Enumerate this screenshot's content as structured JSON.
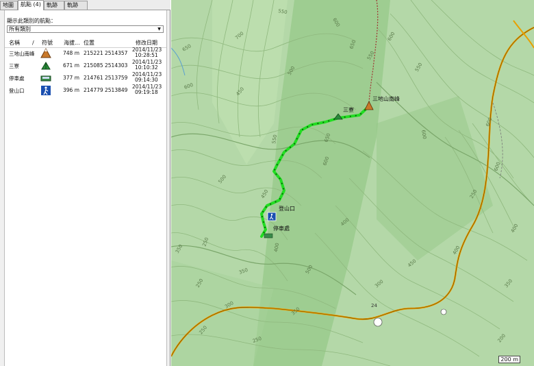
{
  "tabs": [
    {
      "label": "地圖"
    },
    {
      "label": "航點 (4)"
    },
    {
      "label": "軌跡"
    },
    {
      "label": "軌跡 (1)"
    }
  ],
  "filter": {
    "label": "顯示此類別的航點：",
    "selected": "所有類別"
  },
  "columns": {
    "name": "名稱",
    "sort_marker": "/",
    "symbol": "符號",
    "altitude": "海拔...",
    "position": "位置",
    "modified": "修改日期"
  },
  "waypoints": [
    {
      "name": "三地山南峰",
      "symbol": "summit-icon",
      "altitude": "748 m",
      "position": "215221 2514357",
      "date": "2014/11/23",
      "time": "10:28:51"
    },
    {
      "name": "三寮",
      "symbol": "tent-icon",
      "altitude": "671 m",
      "position": "215085 2514303",
      "date": "2014/11/23",
      "time": "10:10:32"
    },
    {
      "name": "停車處",
      "symbol": "parking-car-icon",
      "altitude": "377 m",
      "position": "214761 2513759",
      "date": "2014/11/23",
      "time": "09:14:30"
    },
    {
      "name": "登山口",
      "symbol": "hiker-icon",
      "altitude": "396 m",
      "position": "214779 2513849",
      "date": "2014/11/23",
      "time": "09:19:18"
    }
  ],
  "map": {
    "waypoint_labels": {
      "summit": "三地山南峰",
      "camp": "三寮",
      "trailhead": "登山口",
      "parking": "停車處"
    },
    "contour_labels": [
      "550",
      "600",
      "650",
      "650",
      "700",
      "600",
      "500",
      "450",
      "550",
      "600",
      "650",
      "500",
      "450",
      "400",
      "350",
      "250",
      "250",
      "550",
      "600",
      "600",
      "400",
      "350",
      "450",
      "350",
      "250",
      "550",
      "600",
      "600",
      "400",
      "350",
      "300",
      "250",
      "250",
      "200",
      "500",
      "400",
      "300"
    ],
    "road_labels": [
      "24"
    ],
    "scale": "200 m",
    "colors": {
      "terrain": "#b4d8a8",
      "contour": "#8fb87e",
      "track": "#22dd22",
      "road": "#e8a000",
      "trail": "#a03030"
    }
  }
}
